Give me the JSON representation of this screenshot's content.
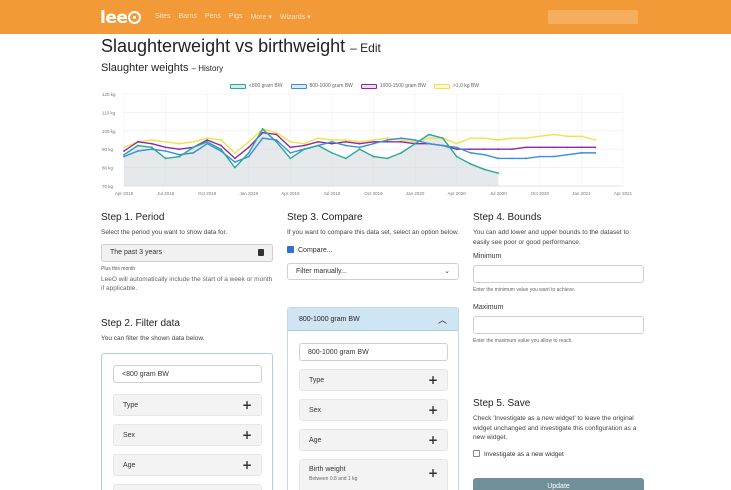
{
  "navbar": {
    "logo": "lee",
    "links": [
      "Sites",
      "Barns",
      "Pens",
      "Pigs",
      "More ▾",
      "Wizards ▾"
    ]
  },
  "page": {
    "title": "Slaughterweight vs birthweight",
    "title_suffix": "– Edit",
    "chart_heading": "Slaughter weights",
    "chart_heading_suffix": "– History"
  },
  "chart_data": {
    "type": "line",
    "title": "",
    "xlabel": "",
    "ylabel": "",
    "y_ticks": [
      "120 kg",
      "110 kg",
      "100 kg",
      "90 kg",
      "80 kg",
      "70 kg"
    ],
    "ylim": [
      70,
      120
    ],
    "x_ticks": [
      "Apr 2018",
      "Jul 2018",
      "Oct 2018",
      "Jan 2019",
      "Apr 2019",
      "Jul 2019",
      "Oct 2019",
      "Jan 2020",
      "Apr 2020",
      "Jul 2020",
      "Oct 2020",
      "Jan 2021",
      "Apr 2021"
    ],
    "xlim": [
      0,
      36
    ],
    "legend": "top",
    "series": [
      {
        "name": "<800 gram BW",
        "color": "#2aa79b",
        "fill": true,
        "x": [
          0,
          1,
          2,
          3,
          4,
          5,
          6,
          7,
          8,
          9,
          10,
          11,
          12,
          13,
          14,
          15,
          16,
          17,
          18,
          19,
          20,
          21,
          22,
          23,
          24,
          25,
          26,
          27
        ],
        "y": [
          87,
          92,
          91,
          85,
          86,
          91,
          94,
          90,
          80,
          88,
          101,
          94,
          85,
          90,
          92,
          88,
          85,
          90,
          86,
          85,
          88,
          93,
          98,
          96,
          86,
          82,
          79,
          77
        ]
      },
      {
        "name": "800-1000 gram BW",
        "color": "#3b8fd9",
        "fill": false,
        "x": [
          0,
          1,
          2,
          3,
          4,
          5,
          6,
          7,
          8,
          9,
          10,
          11,
          12,
          13,
          14,
          15,
          16,
          17,
          18,
          19,
          20,
          21,
          22,
          23,
          24,
          25,
          26,
          27,
          28,
          29,
          30,
          31,
          32,
          33,
          34
        ],
        "y": [
          86,
          89,
          90,
          89,
          87,
          88,
          93,
          89,
          83,
          86,
          96,
          95,
          88,
          90,
          92,
          94,
          92,
          91,
          93,
          95,
          96,
          95,
          93,
          92,
          91,
          88,
          87,
          85,
          85,
          85,
          86,
          86,
          87,
          88,
          88
        ]
      },
      {
        "name": "1000-1500 gram BW",
        "color": "#8c2aa6",
        "fill": false,
        "x": [
          0,
          1,
          2,
          3,
          4,
          5,
          6,
          7,
          8,
          9,
          10,
          11,
          12,
          13,
          14,
          15,
          16,
          17,
          18,
          19,
          20,
          21,
          22,
          23,
          24,
          25,
          26,
          27,
          28,
          29,
          30,
          31,
          32,
          33,
          34
        ],
        "y": [
          89,
          94,
          93,
          91,
          90,
          91,
          95,
          92,
          85,
          91,
          99,
          98,
          91,
          92,
          94,
          93,
          94,
          93,
          94,
          94,
          94,
          93,
          93,
          92,
          90,
          90,
          90,
          90,
          90,
          91,
          91,
          91,
          91,
          91,
          91
        ]
      },
      {
        "name": ">1,0 kg BW",
        "color": "#f0e24a",
        "fill": false,
        "x": [
          0,
          1,
          2,
          3,
          4,
          5,
          6,
          7,
          8,
          9,
          10,
          11,
          12,
          13,
          14,
          15,
          16,
          17,
          18,
          19,
          20,
          21,
          22,
          23,
          24,
          25,
          26,
          27,
          28,
          29,
          30,
          31,
          32,
          33,
          34
        ],
        "y": [
          91,
          94,
          95,
          94,
          93,
          94,
          96,
          95,
          88,
          94,
          101,
          99,
          94,
          93,
          96,
          95,
          95,
          94,
          95,
          96,
          95,
          94,
          96,
          96,
          93,
          96,
          96,
          95,
          96,
          96,
          97,
          98,
          97,
          97,
          95
        ]
      }
    ]
  },
  "step1": {
    "title": "Step 1. Period",
    "desc": "Select the period you want to show data for.",
    "period_value": "The past 3 years",
    "note": "Plus this month",
    "help": "LeeO will automatically include the start of a week or month if applicable."
  },
  "step2": {
    "title": "Step 2. Filter data",
    "desc": "You can filter the shown data below.",
    "name_value": "<800 gram BW",
    "rows": [
      "Type",
      "Sex",
      "Age"
    ]
  },
  "step3": {
    "title": "Step 3. Compare",
    "desc": "If you want to compare this data set, select an option below.",
    "compare_label": "Compare...",
    "filter_select": "Filter manually...",
    "accordion_title": "800-1000 gram BW",
    "accordion_input": "800-1000 gram BW",
    "rows": [
      "Type",
      "Sex",
      "Age",
      "Birth weight"
    ],
    "birth_weight_sub": "Between 0.8 and 1 kg"
  },
  "step4": {
    "title": "Step 4. Bounds",
    "desc": "You can add lower and upper bounds to the dataset to easily see poor or good performance.",
    "min_label": "Minimum",
    "min_help": "Enter the minimum value you want to achieve.",
    "max_label": "Maximum",
    "max_help": "Enter the maximum value you allow to reach."
  },
  "step5": {
    "title": "Step 5. Save",
    "desc": "Check 'Investigate as a new widget' to leave the original widget unchanged and investigate this configuration as a new widget.",
    "checkbox_label": "Investigate as a new widget",
    "button": "Update"
  }
}
